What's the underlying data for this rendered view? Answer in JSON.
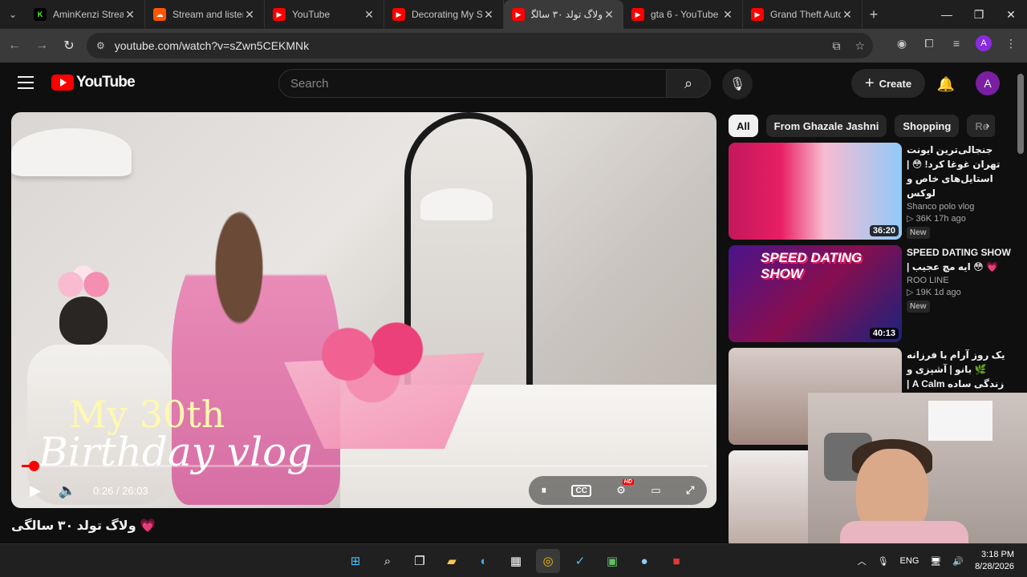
{
  "browser": {
    "tabs": [
      {
        "label": "AminKenzi Stream",
        "favicon_letter": "K",
        "favicon_color": "#53fc18",
        "active": false
      },
      {
        "label": "Stream and listen",
        "favicon_letter": "",
        "favicon_color": "#ff5500",
        "active": false
      },
      {
        "label": "YouTube",
        "favicon_letter": "",
        "favicon_color": "#ff0000",
        "active": false
      },
      {
        "label": "Decorating My Sh",
        "favicon_letter": "",
        "favicon_color": "#ff0000",
        "active": false
      },
      {
        "label": "ولاگ تولد ۳۰ سالگ",
        "favicon_letter": "",
        "favicon_color": "#ff0000",
        "active": true
      },
      {
        "label": "gta 6 - YouTube",
        "favicon_letter": "",
        "favicon_color": "#ff0000",
        "active": false
      },
      {
        "label": "Grand Theft Auto",
        "favicon_letter": "",
        "favicon_color": "#ff0000",
        "active": false
      }
    ],
    "url": "youtube.com/watch?v=sZwn5CEKMNk",
    "profile_initial": "A"
  },
  "youtube": {
    "logo_text": "YouTube",
    "search_placeholder": "Search",
    "create_label": "Create",
    "avatar_initial": "A",
    "player": {
      "overlay_title": "My 30th",
      "overlay_script": "Birthday vlog",
      "current_time": "0:26",
      "duration": "26:03",
      "time_display": "0:26 / 26:03",
      "progress": 0.017
    },
    "video_title": "ولاگ تولد ۳۰ سالگی 💗",
    "chips": [
      {
        "label": "All",
        "selected": true
      },
      {
        "label": "From Ghazale Jashni",
        "selected": false
      },
      {
        "label": "Shopping",
        "selected": false
      },
      {
        "label": "Re",
        "selected": false
      }
    ],
    "recommendations": [
      {
        "title": "جنجالی‌ترین ایونت تهران غوغا کرد! 😳 | استایل‌های خاص و لوکس",
        "channel": "Shanco polo vlog",
        "stats": "▷ 36K  17h ago",
        "badge": "New",
        "duration": "36:20"
      },
      {
        "title": "SPEED DATING SHOW | ایه مچ عجیب 😳 💗",
        "channel": "ROO LINE",
        "stats": "▷ 19K  1d ago",
        "badge": "New",
        "duration": "40:13",
        "thumb_text": "SPEED DATING SHOW"
      },
      {
        "title": "یک روز آرام با فرزانه 🌿 بانو | آشپزی و زندگی ساده A Calm | یک مادر ایرانی...",
        "channel": "",
        "stats": "",
        "badge": "",
        "duration": ""
      }
    ]
  },
  "taskbar": {
    "language": "ENG",
    "time": "3:18 PM",
    "date": "8/28/2026"
  }
}
